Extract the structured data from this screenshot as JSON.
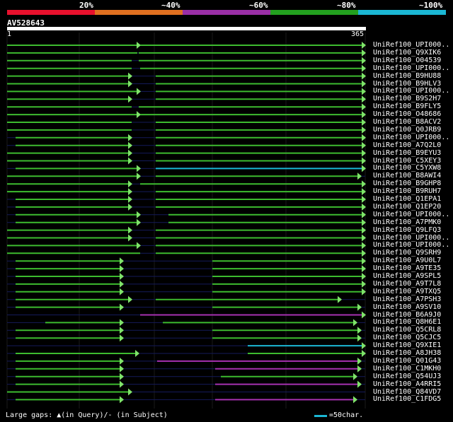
{
  "legend": {
    "labels": [
      "20%",
      "~40%",
      "~60%",
      "~80%",
      "~100%"
    ],
    "colors": [
      "#e8112d",
      "#e07020",
      "#9a2fa6",
      "#23a01f",
      "#1bb7d4"
    ]
  },
  "query": {
    "title": "AV528643",
    "start": "1",
    "end": "365"
  },
  "hits": [
    {
      "label": "UniRef100_UPI000..",
      "segs": [
        [
          10,
          198,
          "#3dbb2f",
          1
        ],
        [
          198,
          516,
          "#3dbb2f",
          1
        ]
      ]
    },
    {
      "label": "UniRef100_Q9XIK6",
      "segs": [
        [
          10,
          194,
          "#3dbb2f",
          0
        ],
        [
          196,
          516,
          "#3dbb2f",
          1
        ]
      ]
    },
    {
      "label": "UniRef100_O04539",
      "segs": [
        [
          10,
          186,
          "#3dbb2f",
          0
        ],
        [
          196,
          516,
          "#3dbb2f",
          1
        ]
      ]
    },
    {
      "label": "UniRef100_UPI000..",
      "segs": [
        [
          10,
          186,
          "#3dbb2f",
          0
        ],
        [
          198,
          516,
          "#3dbb2f",
          1
        ]
      ]
    },
    {
      "label": "UniRef100_B9HU88",
      "segs": [
        [
          10,
          186,
          "#3dbb2f",
          1
        ],
        [
          220,
          516,
          "#3dbb2f",
          1
        ]
      ]
    },
    {
      "label": "UniRef100_B9HLV3",
      "segs": [
        [
          10,
          186,
          "#3dbb2f",
          1
        ],
        [
          220,
          516,
          "#3dbb2f",
          1
        ]
      ]
    },
    {
      "label": "UniRef100_UPI000..",
      "segs": [
        [
          10,
          198,
          "#3dbb2f",
          1
        ],
        [
          220,
          516,
          "#3dbb2f",
          1
        ]
      ]
    },
    {
      "label": "UniRef100_B9S2H7",
      "segs": [
        [
          10,
          186,
          "#3dbb2f",
          1
        ],
        [
          220,
          516,
          "#3dbb2f",
          1
        ]
      ]
    },
    {
      "label": "UniRef100_B9FLY5",
      "segs": [
        [
          10,
          186,
          "#3dbb2f",
          0
        ],
        [
          196,
          516,
          "#3dbb2f",
          1
        ]
      ]
    },
    {
      "label": "UniRef100_O48686",
      "segs": [
        [
          10,
          198,
          "#3dbb2f",
          1
        ],
        [
          198,
          516,
          "#3dbb2f",
          1
        ]
      ]
    },
    {
      "label": "UniRef100_B8ACV2",
      "segs": [
        [
          10,
          186,
          "#3dbb2f",
          0
        ],
        [
          220,
          516,
          "#3dbb2f",
          1
        ]
      ]
    },
    {
      "label": "UniRef100_Q0JRB9",
      "segs": [
        [
          10,
          186,
          "#3dbb2f",
          0
        ],
        [
          220,
          516,
          "#3dbb2f",
          1
        ]
      ]
    },
    {
      "label": "UniRef100_UPI000..",
      "segs": [
        [
          22,
          186,
          "#3dbb2f",
          1
        ],
        [
          220,
          516,
          "#3dbb2f",
          1
        ]
      ]
    },
    {
      "label": "UniRef100_A7Q2L0",
      "segs": [
        [
          22,
          186,
          "#3dbb2f",
          1
        ],
        [
          220,
          516,
          "#3dbb2f",
          1
        ]
      ]
    },
    {
      "label": "UniRef100_B9EYU3",
      "segs": [
        [
          10,
          186,
          "#3dbb2f",
          1
        ],
        [
          220,
          516,
          "#3dbb2f",
          1
        ]
      ]
    },
    {
      "label": "UniRef100_C5XEY3",
      "segs": [
        [
          10,
          186,
          "#3dbb2f",
          1
        ],
        [
          220,
          516,
          "#3dbb2f",
          1
        ]
      ]
    },
    {
      "label": "UniRef100_C5YXW8",
      "segs": [
        [
          22,
          198,
          "#3dbb2f",
          1
        ],
        [
          220,
          516,
          "#1bb7d4",
          1
        ]
      ]
    },
    {
      "label": "UniRef100_B8AWI4",
      "segs": [
        [
          10,
          198,
          "#3dbb2f",
          1
        ],
        [
          220,
          510,
          "#3dbb2f",
          1
        ]
      ]
    },
    {
      "label": "UniRef100_B9GHP8",
      "segs": [
        [
          10,
          186,
          "#3dbb2f",
          1
        ],
        [
          198,
          516,
          "#3dbb2f",
          1
        ]
      ]
    },
    {
      "label": "UniRef100_B9RUH7",
      "segs": [
        [
          10,
          186,
          "#3dbb2f",
          1
        ],
        [
          220,
          516,
          "#3dbb2f",
          1
        ]
      ]
    },
    {
      "label": "UniRef100_Q1EPA1",
      "segs": [
        [
          22,
          186,
          "#3dbb2f",
          1
        ],
        [
          220,
          516,
          "#3dbb2f",
          1
        ]
      ]
    },
    {
      "label": "UniRef100_Q1EP20",
      "segs": [
        [
          22,
          186,
          "#3dbb2f",
          1
        ],
        [
          220,
          516,
          "#3dbb2f",
          1
        ]
      ]
    },
    {
      "label": "UniRef100_UPI000..",
      "segs": [
        [
          22,
          198,
          "#3dbb2f",
          1
        ],
        [
          238,
          516,
          "#3dbb2f",
          1
        ]
      ]
    },
    {
      "label": "UniRef100_A7PMK0",
      "segs": [
        [
          22,
          198,
          "#3dbb2f",
          1
        ],
        [
          238,
          516,
          "#3dbb2f",
          1
        ]
      ]
    },
    {
      "label": "UniRef100_Q9LFQ3",
      "segs": [
        [
          10,
          186,
          "#3dbb2f",
          1
        ],
        [
          220,
          516,
          "#3dbb2f",
          1
        ]
      ]
    },
    {
      "label": "UniRef100_UPI000..",
      "segs": [
        [
          10,
          186,
          "#3dbb2f",
          1
        ],
        [
          220,
          516,
          "#3dbb2f",
          1
        ]
      ]
    },
    {
      "label": "UniRef100_UPI000..",
      "segs": [
        [
          10,
          198,
          "#3dbb2f",
          1
        ],
        [
          220,
          516,
          "#3dbb2f",
          1
        ]
      ]
    },
    {
      "label": "UniRef100_Q9SRH9",
      "segs": [
        [
          10,
          198,
          "#3dbb2f",
          0
        ],
        [
          220,
          516,
          "#3dbb2f",
          1
        ]
      ]
    },
    {
      "label": "UniRef100_A9U0L7",
      "segs": [
        [
          22,
          174,
          "#3dbb2f",
          1
        ],
        [
          300,
          516,
          "#3dbb2f",
          1
        ]
      ]
    },
    {
      "label": "UniRef100_A9TE35",
      "segs": [
        [
          22,
          174,
          "#3dbb2f",
          1
        ],
        [
          300,
          516,
          "#3dbb2f",
          1
        ]
      ]
    },
    {
      "label": "UniRef100_A9SPL5",
      "segs": [
        [
          22,
          174,
          "#3dbb2f",
          1
        ],
        [
          300,
          516,
          "#3dbb2f",
          1
        ]
      ]
    },
    {
      "label": "UniRef100_A9T7L8",
      "segs": [
        [
          22,
          174,
          "#3dbb2f",
          1
        ],
        [
          300,
          516,
          "#3dbb2f",
          1
        ]
      ]
    },
    {
      "label": "UniRef100_A9TXQ5",
      "segs": [
        [
          22,
          174,
          "#3dbb2f",
          1
        ],
        [
          300,
          516,
          "#3dbb2f",
          1
        ]
      ]
    },
    {
      "label": "UniRef100_A7PSH3",
      "segs": [
        [
          22,
          186,
          "#3dbb2f",
          1
        ],
        [
          220,
          482,
          "#3dbb2f",
          1
        ]
      ]
    },
    {
      "label": "UniRef100_A9SV10",
      "segs": [
        [
          22,
          174,
          "#3dbb2f",
          1
        ],
        [
          300,
          510,
          "#3dbb2f",
          1
        ]
      ]
    },
    {
      "label": "UniRef100_B6A9J0",
      "segs": [
        [
          198,
          516,
          "#a631b0",
          1
        ]
      ]
    },
    {
      "label": "UniRef100_Q8H6E1",
      "segs": [
        [
          64,
          174,
          "#3dbb2f",
          1
        ],
        [
          230,
          504,
          "#3dbb2f",
          1
        ]
      ]
    },
    {
      "label": "UniRef100_Q5CRL8",
      "segs": [
        [
          22,
          174,
          "#3dbb2f",
          1
        ],
        [
          300,
          510,
          "#3dbb2f",
          1
        ]
      ]
    },
    {
      "label": "UniRef100_Q5CJC5",
      "segs": [
        [
          22,
          174,
          "#3dbb2f",
          1
        ],
        [
          300,
          510,
          "#3dbb2f",
          1
        ]
      ]
    },
    {
      "label": "UniRef100_Q9XIE1",
      "segs": [
        [
          350,
          516,
          "#1bb7d4",
          1
        ]
      ]
    },
    {
      "label": "UniRef100_A8JH38",
      "segs": [
        [
          22,
          196,
          "#3dbb2f",
          1
        ],
        [
          350,
          516,
          "#3dbb2f",
          1
        ]
      ]
    },
    {
      "label": "UniRef100_Q01G43",
      "segs": [
        [
          22,
          174,
          "#3dbb2f",
          1
        ],
        [
          222,
          510,
          "#a631b0",
          1
        ]
      ]
    },
    {
      "label": "UniRef100_C1MKH0",
      "segs": [
        [
          22,
          174,
          "#3dbb2f",
          1
        ],
        [
          304,
          510,
          "#a631b0",
          1
        ]
      ]
    },
    {
      "label": "UniRef100_Q54UJ3",
      "segs": [
        [
          22,
          174,
          "#3dbb2f",
          1
        ],
        [
          312,
          504,
          "#3dbb2f",
          1
        ]
      ]
    },
    {
      "label": "UniRef100_A4RRI5",
      "segs": [
        [
          22,
          174,
          "#3dbb2f",
          1
        ],
        [
          304,
          510,
          "#a631b0",
          1
        ]
      ]
    },
    {
      "label": "UniRef100_Q84VD7",
      "segs": [
        [
          10,
          186,
          "#3dbb2f",
          1
        ]
      ]
    },
    {
      "label": "UniRef100_C1FDG5",
      "segs": [
        [
          22,
          174,
          "#3dbb2f",
          1
        ],
        [
          304,
          504,
          "#a631b0",
          1
        ]
      ]
    }
  ],
  "footer": {
    "text": "Large gaps: ▲(in Query)/- (in Subject)",
    "scale_label": "=50char."
  }
}
